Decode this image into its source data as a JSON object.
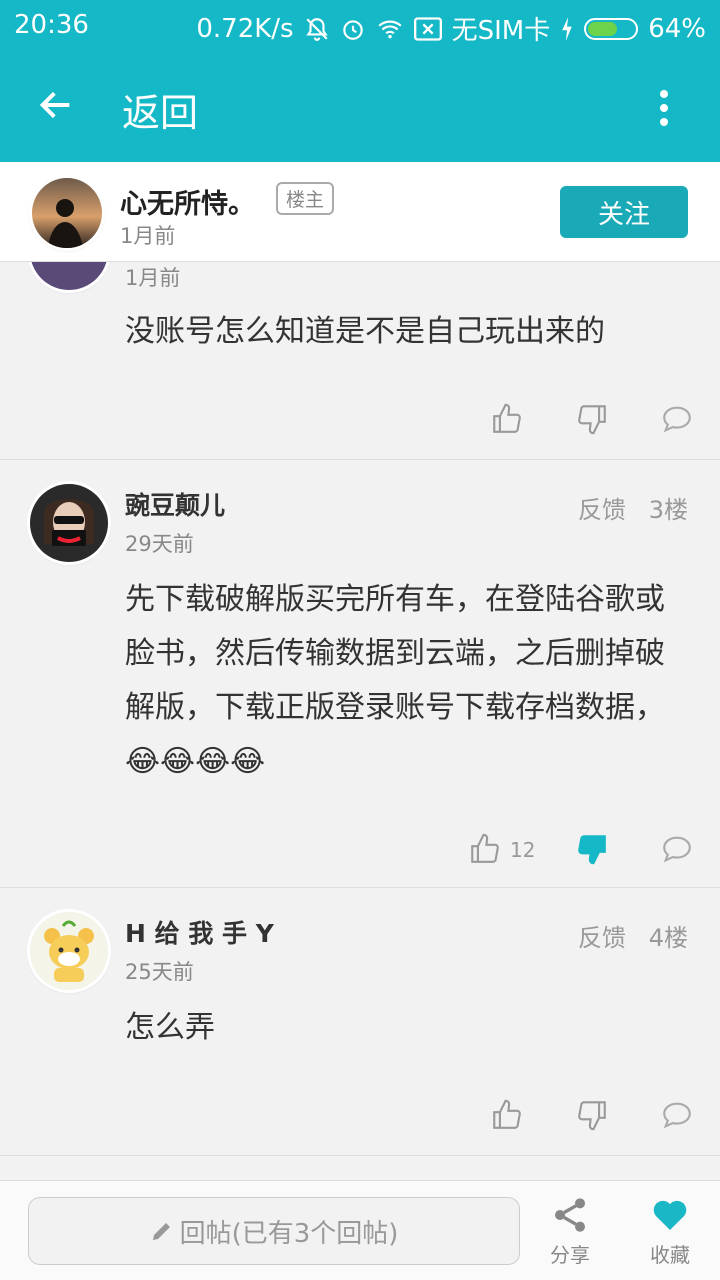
{
  "status": {
    "time": "20:36",
    "speed": "0.72K/s",
    "sim": "无SIM卡",
    "battery_pct": "64%",
    "battery_level": 0.64
  },
  "appbar": {
    "title": "返回"
  },
  "op": {
    "name": "心无所恃。",
    "badge": "楼主",
    "time": "1月前",
    "follow_label": "关注"
  },
  "posts": [
    {
      "time": "1月前",
      "content": "没账号怎么知道是不是自己玩出来的"
    },
    {
      "name": "豌豆颠儿",
      "time": "29天前",
      "feedback": "反馈",
      "floor": "3楼",
      "content": "先下载破解版买完所有车，在登陆谷歌或脸书，然后传输数据到云端，之后删掉破解版，下载正版登录账号下载存档数据，😂😂😂😂",
      "likes": "12"
    },
    {
      "name": "H 给 我 手 Y",
      "time": "25天前",
      "feedback": "反馈",
      "floor": "4楼",
      "content": "怎么弄"
    }
  ],
  "bottom": {
    "reply_placeholder": "回帖(已有3个回帖)",
    "share_label": "分享",
    "favorite_label": "收藏"
  },
  "colors": {
    "accent": "#14b8c6",
    "button": "#1aa9b6",
    "heart": "#1ab8c6"
  }
}
